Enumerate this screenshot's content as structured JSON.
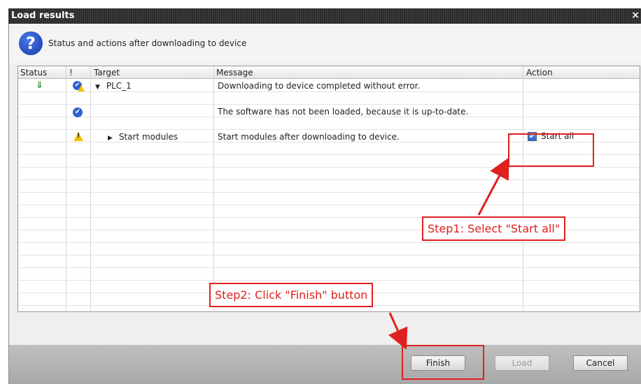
{
  "window": {
    "title": "Load results",
    "close_glyph": "×"
  },
  "header": {
    "icon": "question-icon",
    "text": "Status and actions after downloading to device"
  },
  "table": {
    "columns": [
      "Status",
      "!",
      "Target",
      "Message",
      "Action"
    ],
    "rows": [
      {
        "status_icon": "download-icon",
        "flag_icon": "check-warning-icon",
        "expander": "▼",
        "target": "PLC_1",
        "message": "Downloading to device completed without error.",
        "action": ""
      },
      {
        "status_icon": "",
        "flag_icon": "check-icon",
        "expander": "",
        "target": "",
        "message": "The software has not been loaded, because it is up-to-date.",
        "action": ""
      },
      {
        "status_icon": "",
        "flag_icon": "warning-icon",
        "expander": "▶",
        "target": "Start modules",
        "message": "Start modules after downloading to device.",
        "action": "Start all",
        "action_checked": true
      }
    ]
  },
  "annotations": {
    "step1": "Step1: Select \"Start all\"",
    "step2": "Step2: Click \"Finish\" button",
    "color": "#e02020"
  },
  "buttons": {
    "finish": "Finish",
    "load": "Load",
    "cancel": "Cancel"
  }
}
